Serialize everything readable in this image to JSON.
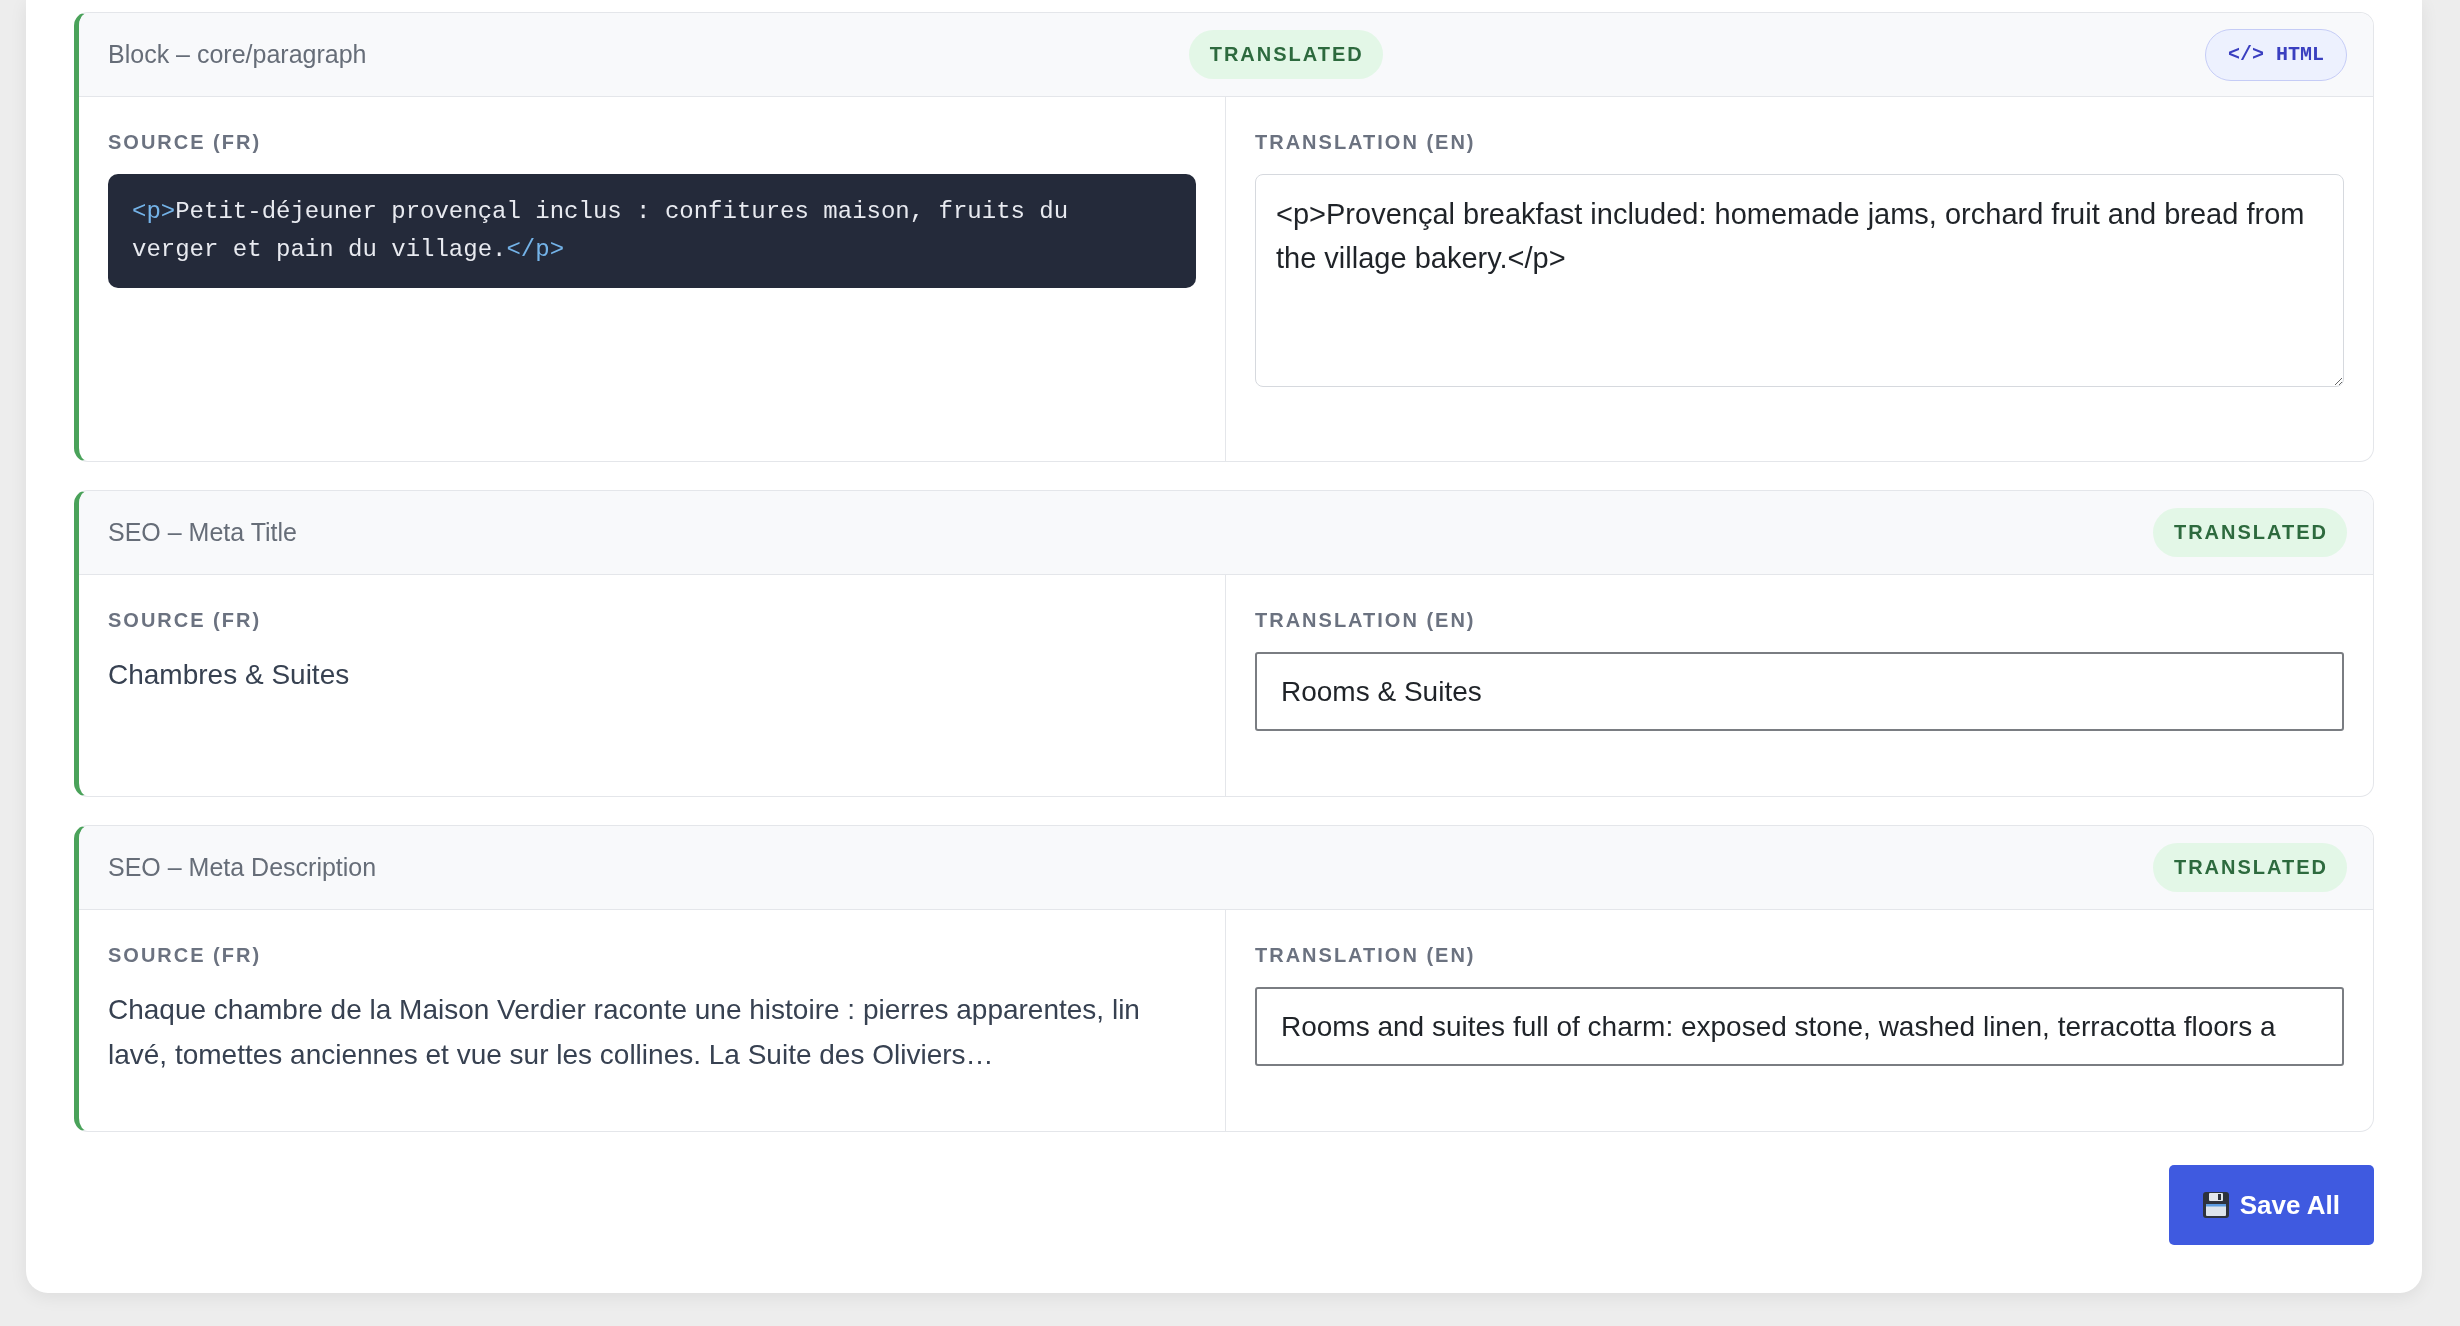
{
  "blocks": [
    {
      "title": "Block – core/paragraph",
      "translated": true,
      "badge": "TRANSLATED",
      "format_button": "</> HTML",
      "source": {
        "label": "SOURCE (FR)",
        "kind": "code",
        "segments": [
          {
            "kind": "tag",
            "text": "<p>"
          },
          {
            "kind": "text",
            "text": "Petit-déjeuner provençal inclus : confitures maison, fruits du verger et pain du village."
          },
          {
            "kind": "tag",
            "text": "</p>"
          }
        ]
      },
      "translation": {
        "label": "TRANSLATION (EN)",
        "kind": "textarea",
        "value": "<p>Provençal breakfast included: homemade jams, orchard fruit and bread from the village bakery.</p>"
      }
    },
    {
      "title": "SEO – Meta Title",
      "translated": true,
      "badge": "TRANSLATED",
      "source": {
        "label": "SOURCE (FR)",
        "kind": "text",
        "text": "Chambres & Suites"
      },
      "translation": {
        "label": "TRANSLATION (EN)",
        "kind": "input",
        "value": "Rooms & Suites"
      }
    },
    {
      "title": "SEO – Meta Description",
      "translated": true,
      "badge": "TRANSLATED",
      "source": {
        "label": "SOURCE (FR)",
        "kind": "text",
        "text": "Chaque chambre de la Maison Verdier raconte une histoire : pierres apparentes, lin lavé, tomettes anciennes et vue sur les collines. La Suite des Oliviers…"
      },
      "translation": {
        "label": "TRANSLATION (EN)",
        "kind": "input",
        "value": "Rooms and suites full of charm: exposed stone, washed linen, terracotta floors a"
      }
    }
  ],
  "save_button": {
    "label": "Save All"
  }
}
